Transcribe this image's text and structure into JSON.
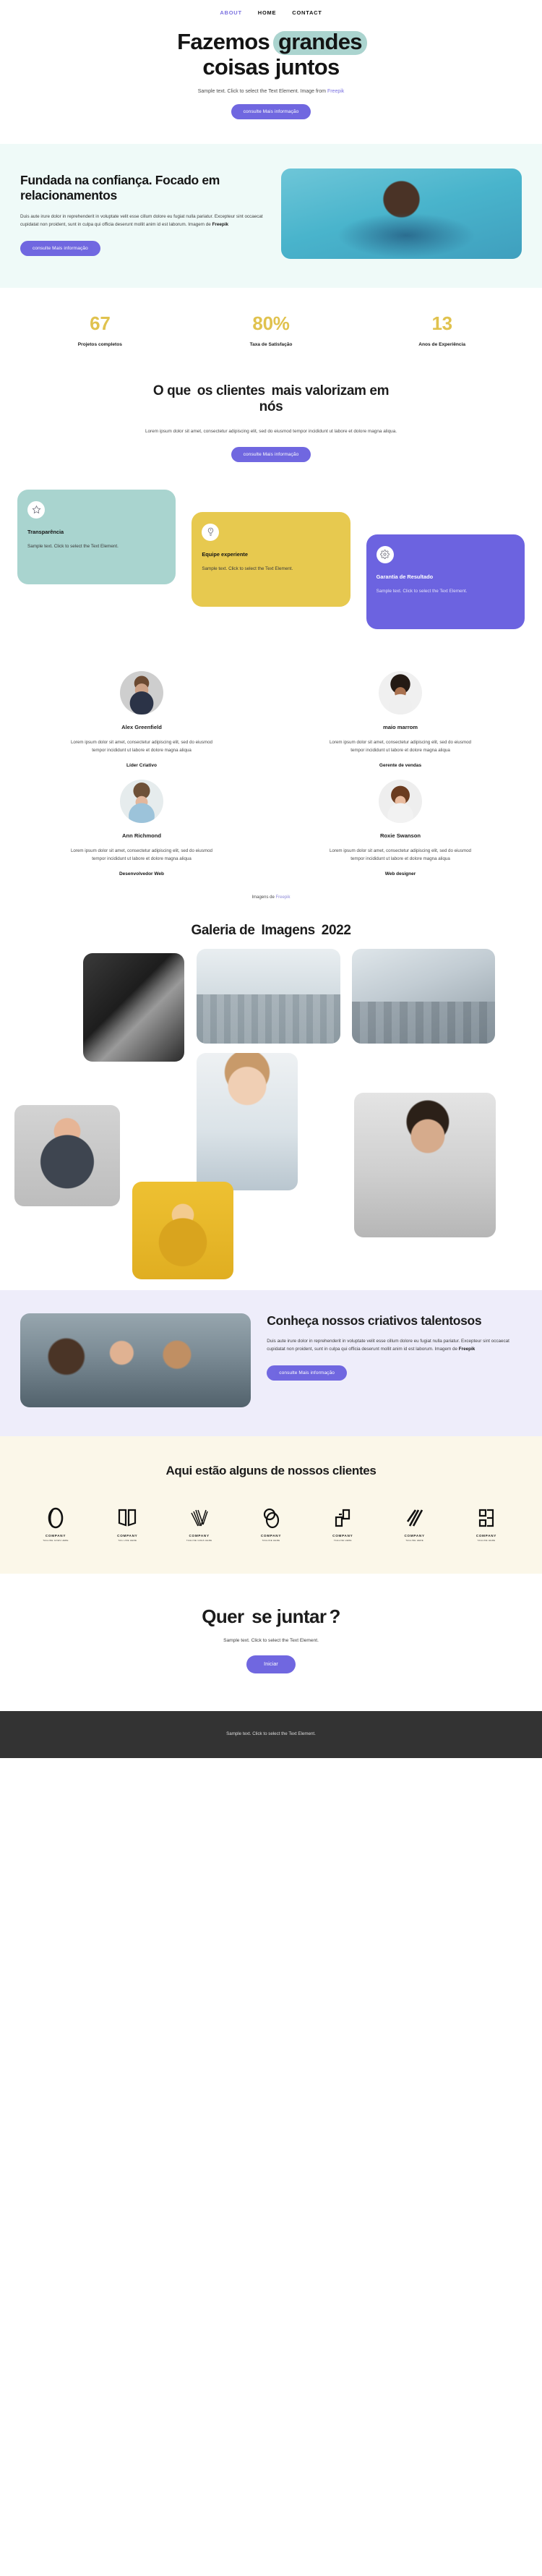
{
  "nav": {
    "items": [
      {
        "label": "ABOUT",
        "active": true
      },
      {
        "label": "HOME",
        "active": false
      },
      {
        "label": "CONTACT",
        "active": false
      }
    ]
  },
  "hero": {
    "title_line1_plain": "Fazemos ",
    "title_line1_highlight": "grandes",
    "title_line2": "coisas juntos",
    "subtitle_prefix": "Sample text. Click to select the Text Element. Image from ",
    "subtitle_link": "Freepik",
    "cta_label": "consulte Mais informação"
  },
  "founded": {
    "heading": "Fundada na confiança. Focado em relacionamentos",
    "body_prefix": "Duis aute irure dolor in reprehenderit in voluptate velit esse cillum dolore eu fugiat nulla pariatur. Excepteur sint occaecat cupidatat non proident, sunt in culpa qui officia deserunt mollit anim id est laborum. Imagem de ",
    "body_bold": "Freepik",
    "cta_label": "consulte Mais informação",
    "image_alt": "woman-in-blue-sweater-portrait"
  },
  "stats": [
    {
      "number": "67",
      "label": "Projetos completos"
    },
    {
      "number": "80%",
      "label": "Taxa de Satisfação"
    },
    {
      "number": "13",
      "label": "Anos de Experiência"
    }
  ],
  "values": {
    "heading_pre": "O que ",
    "heading_highlight": "os clientes",
    "heading_post": " mais valorizam em nós",
    "lead": "Lorem ipsum dolor sit amet, consectetur adipiscing elit, sed do eiusmod tempor incididunt ut labore et dolore magna aliqua.",
    "cta_label": "consulte Mais informação",
    "cards": [
      {
        "icon": "star-icon",
        "title": "Transparência",
        "text": "Sample text. Click to select the Text Element.",
        "color": "#a9d4cf"
      },
      {
        "icon": "lightbulb-icon",
        "title": "Equipe experiente",
        "text": "Sample text. Click to select the Text Element.",
        "color": "#e7c94f"
      },
      {
        "icon": "gear-icon",
        "title": "Garantia de Resultado",
        "text": "Sample text. Click to select the Text Element.",
        "color": "#6c63e0"
      }
    ]
  },
  "team": {
    "members": [
      {
        "name": "Alex Greenfield",
        "bio": "Lorem ipsum dolor sit amet, consectetur adipiscing elit, sed do eiusmod tempor incididunt ut labore et dolore magna aliqua",
        "role": "Líder Criativo"
      },
      {
        "name": "maio marrom",
        "bio": "Lorem ipsum dolor sit amet, consectetur adipiscing elit, sed do eiusmod tempor incididunt ut labore et dolore magna aliqua",
        "role": "Gerente de vendas"
      },
      {
        "name": "Ann Richmond",
        "bio": "Lorem ipsum dolor sit amet, consectetur adipiscing elit, sed do eiusmod tempor incididunt ut labore et dolore magna aliqua",
        "role": "Desenvolvedor Web"
      },
      {
        "name": "Roxie Swanson",
        "bio": "Lorem ipsum dolor sit amet, consectetur adipiscing elit, sed do eiusmod tempor incididunt ut labore et dolore magna aliqua",
        "role": "Web designer"
      }
    ],
    "credit_prefix": "Imagens de ",
    "credit_link": "Freepik"
  },
  "gallery": {
    "heading_pre": "Galeria de ",
    "heading_highlight": "Imagens",
    "heading_post": " 2022"
  },
  "creatives": {
    "heading": "Conheça nossos criativos talentosos",
    "body_prefix": "Duis aute irure dolor in reprehenderit in voluptate velit esse cillum dolore eu fugiat nulla pariatur. Excepteur sint occaecat cupidatat non proident, sunt in culpa qui officia deserunt mollit anim id est laborum. Imagem de ",
    "body_bold": "Freepik",
    "cta_label": "consulte Mais informação"
  },
  "clients": {
    "heading": "Aqui estão alguns de nossos clientes",
    "logos": [
      {
        "name": "COMPANY",
        "tagline": "TAGLINE GOES HERE",
        "mark": "o-ring-mark"
      },
      {
        "name": "COMPANY",
        "tagline": "TAG LINE HERE",
        "mark": "open-book-mark"
      },
      {
        "name": "COMPANY",
        "tagline": "TAGLINE GOES HERE",
        "mark": "striped-v-mark"
      },
      {
        "name": "COMPANY",
        "tagline": "TAGLINE HERE",
        "mark": "double-oval-mark"
      },
      {
        "name": "COMPANY",
        "tagline": "TAGLINE HERE",
        "mark": "corner-squares-mark"
      },
      {
        "name": "COMPANY",
        "tagline": "TAGLINE HERE",
        "mark": "slashes-mark"
      },
      {
        "name": "COMPANY",
        "tagline": "TAGLINE HERE",
        "mark": "bracket-b-mark"
      }
    ]
  },
  "join": {
    "heading_pre": "Quer ",
    "heading_highlight": "se juntar",
    "heading_post": "?",
    "subtitle": "Sample text. Click to select the Text Element.",
    "cta_label": "Iniciar"
  },
  "footer": {
    "text": "Sample text. Click to select the Text Element."
  },
  "colors": {
    "accent_purple": "#6c63e0",
    "teal_highlight": "#abd4cf",
    "gold_highlight": "#e4cb55",
    "gold_stat": "#e0c24e",
    "cream_bg": "#fbf7e9",
    "lavender_bg": "#eeedfa",
    "mint_bg": "#effaf8",
    "footer_bg": "#333333"
  }
}
